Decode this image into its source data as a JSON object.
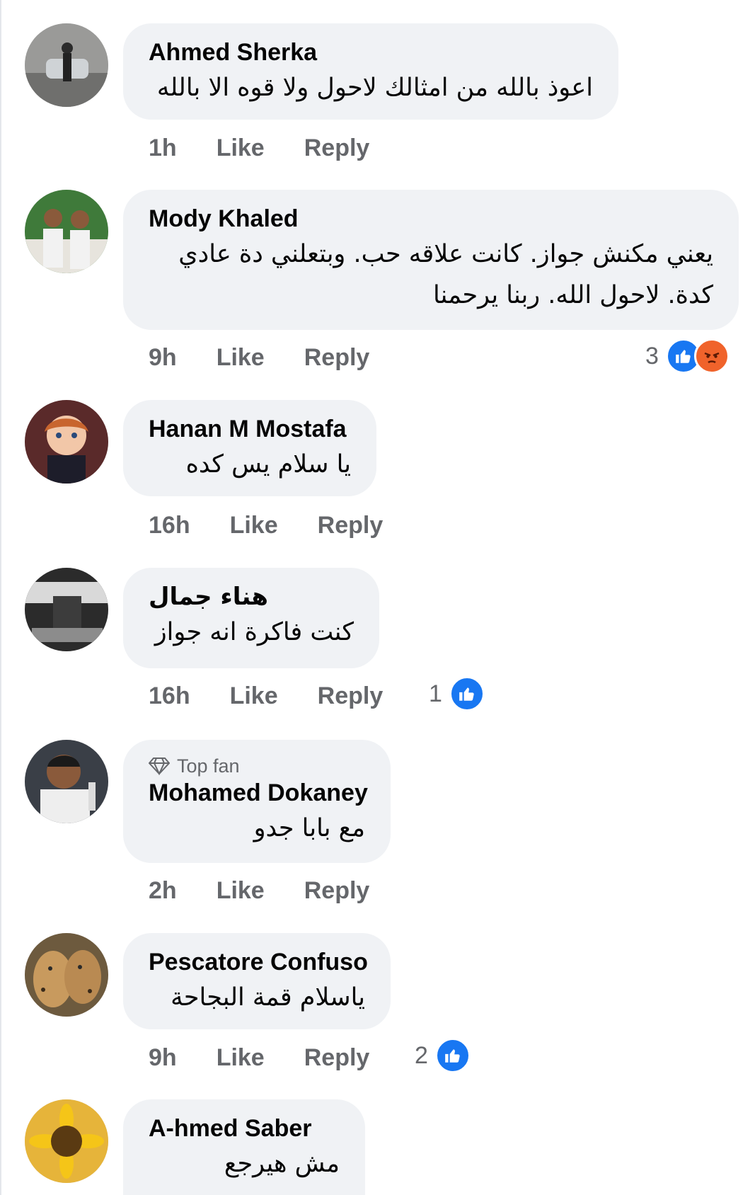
{
  "comments": [
    {
      "author": "Ahmed Sherka",
      "text": [
        "اعوذ بالله من امثالك لاحول ولا قوه الا بالله"
      ],
      "time": "1h",
      "like": "Like",
      "reply": "Reply",
      "reactions": ""
    },
    {
      "author": "Mody Khaled",
      "text": [
        "يعني مكنش جواز.  كانت علاقه حب. وبتعلني دة عادي",
        "كدة. لاحول الله. ربنا يرحمنا"
      ],
      "time": "9h",
      "like": "Like",
      "reply": "Reply",
      "reactions": "3"
    },
    {
      "author": "Hanan M Mostafa",
      "text": [
        "يا سلام يس كده"
      ],
      "time": "16h",
      "like": "Like",
      "reply": "Reply",
      "reactions": ""
    },
    {
      "author": "هناء جمال",
      "text": [
        "كنت فاكرة انه جواز"
      ],
      "time": "16h",
      "like": "Like",
      "reply": "Reply",
      "reactions": "1"
    },
    {
      "badge": "Top fan",
      "author": "Mohamed Dokaney",
      "text": [
        "مع بابا جدو"
      ],
      "time": "2h",
      "like": "Like",
      "reply": "Reply",
      "reactions": ""
    },
    {
      "author": "Pescatore Confuso",
      "text": [
        "ياسلام قمة البجاحة"
      ],
      "time": "9h",
      "like": "Like",
      "reply": "Reply",
      "reactions": "2"
    },
    {
      "author": "A-hmed Saber",
      "text": [
        "مش هيرجع"
      ]
    }
  ],
  "icons": {
    "like": "like-icon",
    "angry": "angry-icon",
    "topfan": "diamond-icon"
  },
  "colors": {
    "bubble": "#f0f2f5",
    "secondary_text": "#65676b",
    "like_blue": "#1877f2",
    "angry_orange": "#f0632b"
  }
}
